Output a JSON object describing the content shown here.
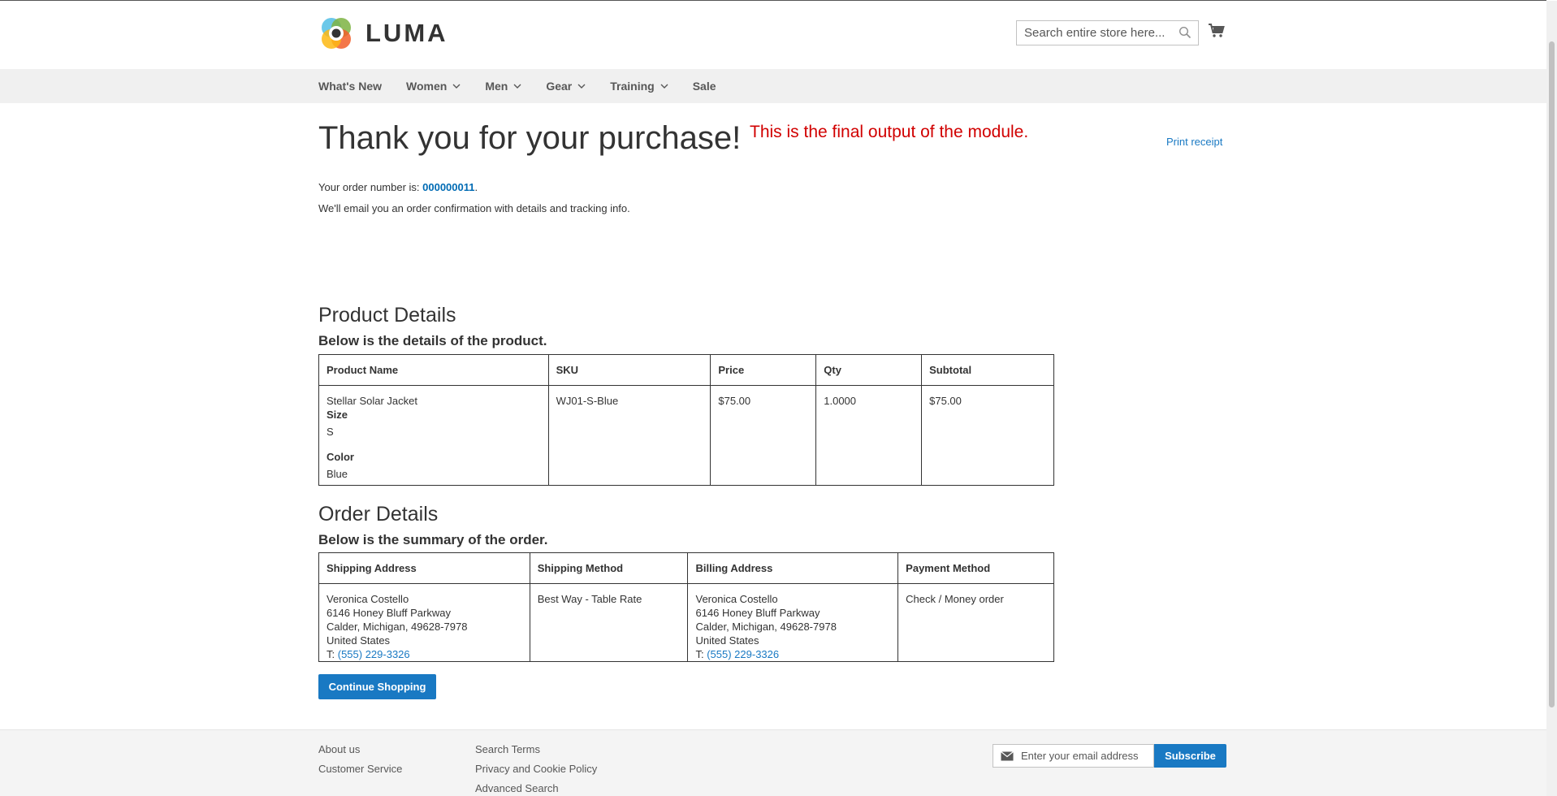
{
  "header": {
    "logo_text": "LUMA",
    "search_placeholder": "Search entire store here..."
  },
  "nav": {
    "items": [
      {
        "label": "What's New",
        "has_dropdown": false
      },
      {
        "label": "Women",
        "has_dropdown": true
      },
      {
        "label": "Men",
        "has_dropdown": true
      },
      {
        "label": "Gear",
        "has_dropdown": true
      },
      {
        "label": "Training",
        "has_dropdown": true
      },
      {
        "label": "Sale",
        "has_dropdown": false
      }
    ]
  },
  "page": {
    "title": "Thank you for your purchase!",
    "note": "This is the final output of the module.",
    "print_label": "Print receipt",
    "order_prefix": "Your order number is: ",
    "order_number": "000000011",
    "order_suffix": ".",
    "email_text": "We'll email you an order confirmation with details and tracking info."
  },
  "product_section": {
    "heading": "Product Details",
    "subheading": "Below is the details of the product.",
    "columns": [
      "Product Name",
      "SKU",
      "Price",
      "Qty",
      "Subtotal"
    ],
    "row": {
      "name": "Stellar Solar Jacket",
      "size_label": "Size",
      "size_value": "S",
      "color_label": "Color",
      "color_value": "Blue",
      "sku": "WJ01-S-Blue",
      "price": "$75.00",
      "qty": "1.0000",
      "subtotal": "$75.00"
    }
  },
  "order_section": {
    "heading": "Order Details",
    "subheading": "Below is the summary of the order.",
    "columns": [
      "Shipping Address",
      "Shipping Method",
      "Billing Address",
      "Payment Method"
    ],
    "shipping_address": {
      "name": "Veronica Costello",
      "street": "6146 Honey Bluff Parkway",
      "city": "Calder, Michigan, 49628-7978",
      "country": "United States",
      "phone_prefix": "T: ",
      "phone": "(555) 229-3326"
    },
    "shipping_method": "Best Way - Table Rate",
    "billing_address": {
      "name": "Veronica Costello",
      "street": "6146 Honey Bluff Parkway",
      "city": "Calder, Michigan, 49628-7978",
      "country": "United States",
      "phone_prefix": "T: ",
      "phone": "(555) 229-3326"
    },
    "payment_method": "Check / Money order"
  },
  "continue_label": "Continue Shopping",
  "footer": {
    "col1": [
      "About us",
      "Customer Service"
    ],
    "col2": [
      "Search Terms",
      "Privacy and Cookie Policy",
      "Advanced Search"
    ],
    "newsletter_placeholder": "Enter your email address",
    "subscribe_label": "Subscribe"
  },
  "colors": {
    "accent": "#1979c3",
    "note_red": "#d10000",
    "nav_bg": "#f0f0f0"
  },
  "icons": [
    "luma-logo-icon",
    "search-icon",
    "cart-icon",
    "chevron-down-icon",
    "mail-icon"
  ]
}
